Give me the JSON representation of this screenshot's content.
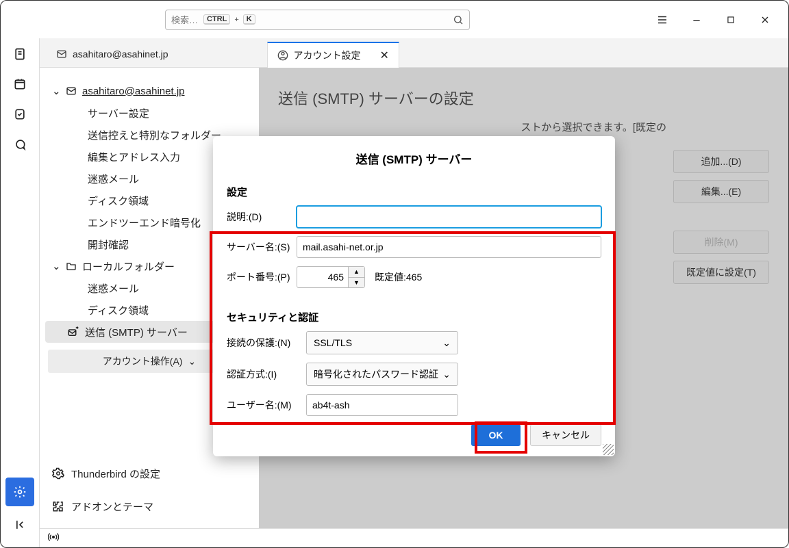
{
  "titlebar": {
    "search_placeholder": "検索…",
    "kbd1": "CTRL",
    "plus": "+",
    "kbd2": "K"
  },
  "tabs": {
    "inactive_label": "asahitaro@asahinet.jp",
    "active_label": "アカウント設定"
  },
  "sidebar": {
    "account": "asahitaro@asahinet.jp",
    "items": [
      "サーバー設定",
      "送信控えと特別なフォルダー",
      "編集とアドレス入力",
      "迷惑メール",
      "ディスク領域",
      "エンドツーエンド暗号化",
      "開封確認"
    ],
    "local_folders": "ローカルフォルダー",
    "local_items": [
      "迷惑メール",
      "ディスク領域"
    ],
    "smtp": "送信 (SMTP) サーバー",
    "account_ops": "アカウント操作(A)",
    "thunderbird_settings": "Thunderbird の設定",
    "addons": "アドオンとテーマ"
  },
  "panel": {
    "title": "送信 (SMTP) サーバーの設定",
    "desc_tail": "ストから選択できます。[既定の",
    "buttons": {
      "add": "追加...(D)",
      "edit": "編集...(E)",
      "delete": "削除(M)",
      "default": "既定値に設定(T)"
    }
  },
  "dialog": {
    "title": "送信 (SMTP) サーバー",
    "section_settings": "設定",
    "section_security": "セキュリティと認証",
    "labels": {
      "description": "説明:(D)",
      "server": "サーバー名:(S)",
      "port": "ポート番号:(P)",
      "default_port_prefix": "既定値:",
      "connection_security": "接続の保護:(N)",
      "auth_method": "認証方式:(I)",
      "username": "ユーザー名:(M)"
    },
    "values": {
      "description": "",
      "server": "mail.asahi-net.or.jp",
      "port": "465",
      "default_port": "465",
      "connection_security": "SSL/TLS",
      "auth_method": "暗号化されたパスワード認証",
      "username": "ab4t-ash"
    },
    "buttons": {
      "ok": "OK",
      "cancel": "キャンセル"
    }
  },
  "statusbar": {
    "broadcast": "((●))"
  }
}
